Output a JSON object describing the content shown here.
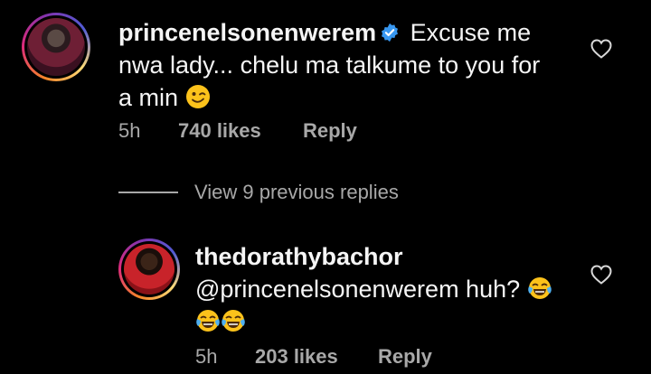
{
  "comment": {
    "username": "princenelsonenwerem",
    "text_line1": "Excuse me",
    "text_line2": "nwa lady... chelu ma talkume to you for",
    "text_line3": "a min",
    "time": "5h",
    "likes": "740 likes",
    "reply_label": "Reply"
  },
  "view_replies": "View 9 previous replies",
  "reply": {
    "username": "thedorathybachor",
    "text": "@princenelsonenwerem huh?",
    "time": "5h",
    "likes": "203 likes",
    "reply_label": "Reply"
  },
  "colors": {
    "background": "#000000",
    "text": "#f5f5f5",
    "muted": "#a8a8a8",
    "verified": "#3897f0"
  },
  "icons": {
    "verified": "verified-badge-icon",
    "wink_emoji": "winking-face-emoji",
    "laugh_emoji": "face-with-tears-of-joy-emoji",
    "like": "heart-outline-icon"
  }
}
